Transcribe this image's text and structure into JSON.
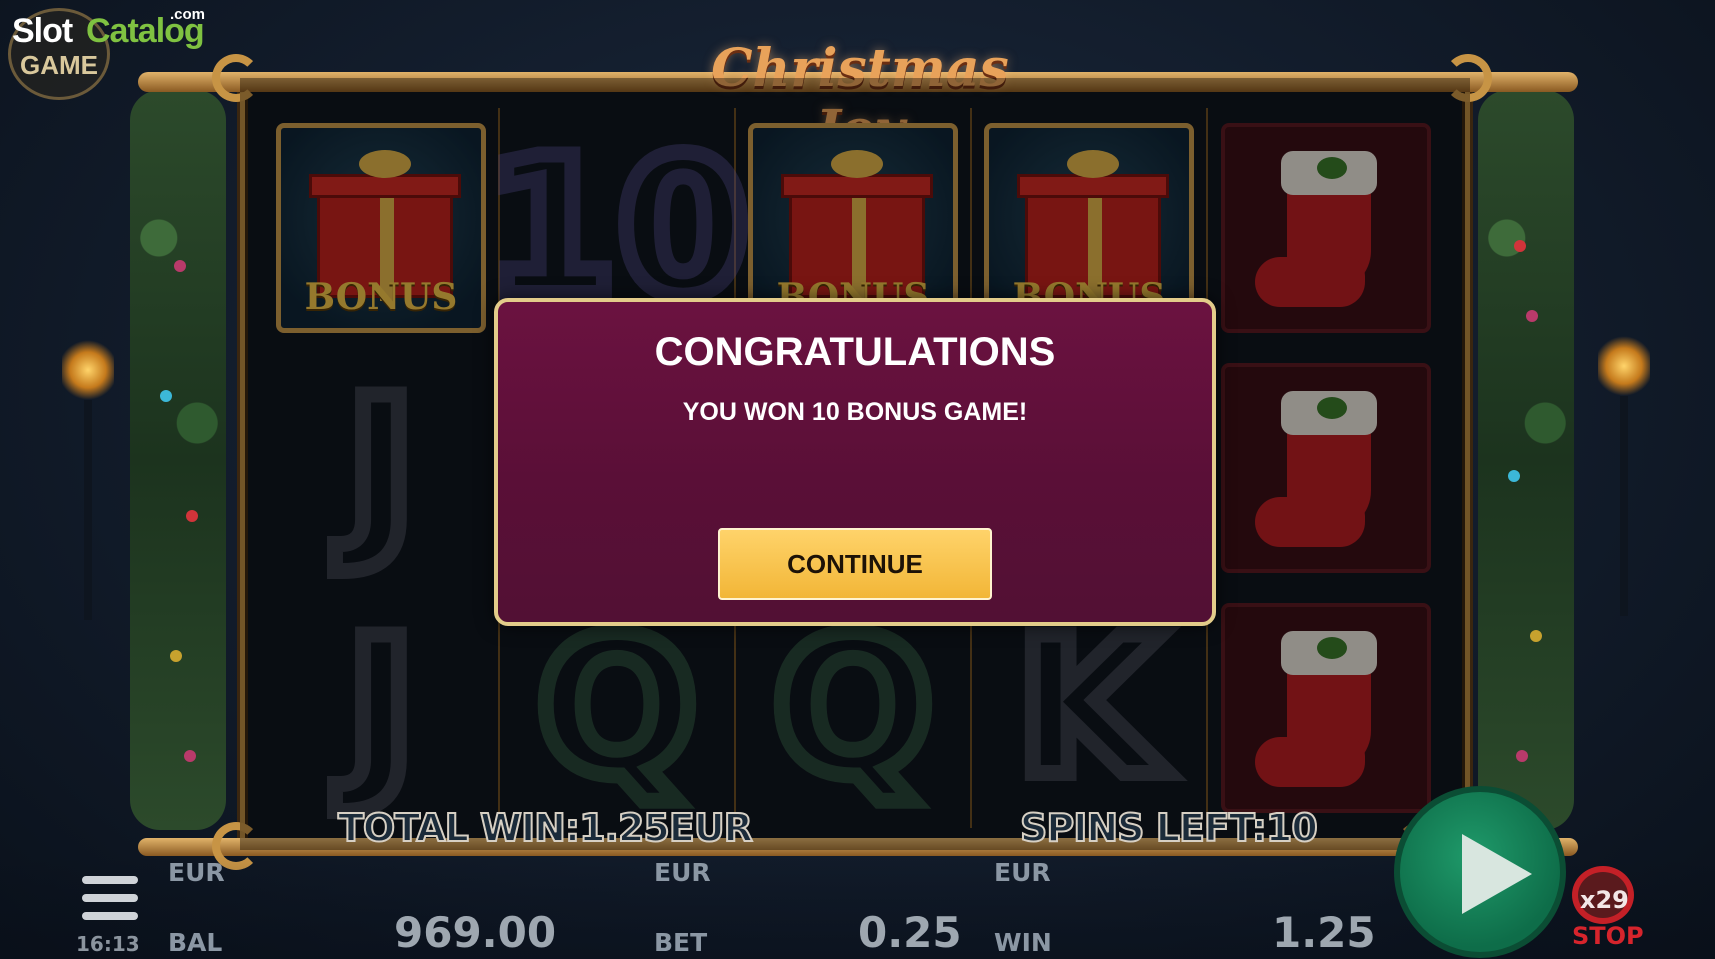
{
  "watermark": {
    "brand_part1": "Slot",
    "brand_part2": "Catalog",
    "domain_suffix": ".com",
    "sub": "GAME"
  },
  "game": {
    "title": "Christmas Joy"
  },
  "reels": {
    "columns": [
      [
        "BONUS",
        "J",
        "J"
      ],
      [
        "10",
        "Q",
        "Q"
      ],
      [
        "BONUS",
        "Q",
        "Q"
      ],
      [
        "BONUS",
        "K",
        "K"
      ],
      [
        "stocking",
        "stocking",
        "stocking"
      ]
    ],
    "bonus_label": "BONUS"
  },
  "frame": {
    "total_win": "TOTAL WIN:1.25EUR",
    "spins_left": "SPINS LEFT:10"
  },
  "modal": {
    "title": "CONGRATULATIONS",
    "message": "YOU WON 10 BONUS GAME!",
    "continue_label": "CONTINUE"
  },
  "bottom_bar": {
    "clock": "16:13",
    "balance": {
      "currency": "EUR",
      "label": "BAL",
      "value": "969.00"
    },
    "bet": {
      "currency": "EUR",
      "label": "BET",
      "value": "0.25"
    },
    "win": {
      "currency": "EUR",
      "label": "WIN",
      "value": "1.25"
    },
    "autospin": {
      "count": "x29",
      "stop_label": "STOP"
    }
  },
  "icons": {
    "menu": "hamburger-menu-icon",
    "spin": "play-triangle-icon",
    "stop": "autospin-stop-icon"
  },
  "colors": {
    "modal_bg": "#5a0f37",
    "modal_border": "#e3cc8a",
    "button_bg": "#f2b637",
    "spin_green": "#0e6d49",
    "stop_red": "#c42027"
  }
}
